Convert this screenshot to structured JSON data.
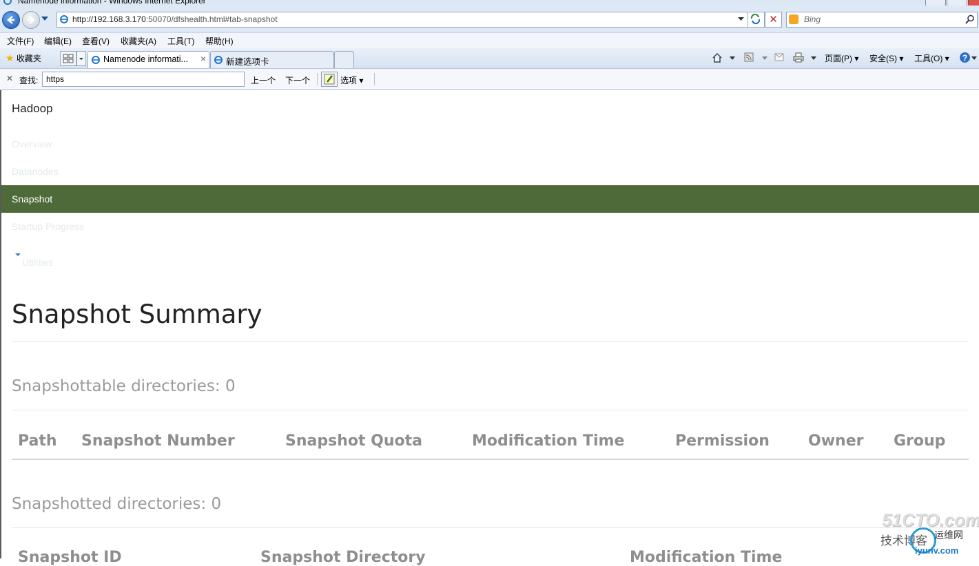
{
  "window": {
    "title": "Namenode information - Windows Internet Explorer"
  },
  "address_bar": {
    "url_host": "http://192.168.3.170",
    "url_rest": ":50070/dfshealth.html#tab-snapshot"
  },
  "search_box": {
    "placeholder": "Bing"
  },
  "menu": [
    "文件(F)",
    "编辑(E)",
    "查看(V)",
    "收藏夹(A)",
    "工具(T)",
    "帮助(H)"
  ],
  "favorites_label": "收藏夹",
  "tabs": [
    {
      "label": "Namenode informati...",
      "active": true
    },
    {
      "label": "新建选项卡",
      "active": false
    }
  ],
  "command_bar": {
    "page": "页面(P)",
    "safety": "安全(S)",
    "tools": "工具(O)"
  },
  "find_bar": {
    "label": "查找:",
    "query": "https",
    "prev": "上一个",
    "next": "下一个",
    "options": "选项"
  },
  "app": {
    "brand": "Hadoop",
    "nav": [
      {
        "label": "Overview",
        "active": false
      },
      {
        "label": "Datanodes",
        "active": false
      },
      {
        "label": "Snapshot",
        "active": true
      },
      {
        "label": "Startup Progress",
        "active": false
      },
      {
        "label": "Utilities",
        "active": false,
        "dropdown": true
      }
    ],
    "accent_color": "#4d6a38"
  },
  "snapshot": {
    "title": "Snapshot Summary",
    "snapshottable_heading": "Snapshottable directories: 0",
    "snapshottable_columns": [
      "Path",
      "Snapshot Number",
      "Snapshot Quota",
      "Modification Time",
      "Permission",
      "Owner",
      "Group"
    ],
    "snapshotted_heading": "Snapshotted directories: 0",
    "snapshotted_columns": [
      "Snapshot ID",
      "Snapshot Directory",
      "Modification Time"
    ]
  },
  "watermark": {
    "site": "51CTO.com",
    "tagline": "技术博客",
    "tagline2": "运维网",
    "domain": "iyunv.com"
  }
}
